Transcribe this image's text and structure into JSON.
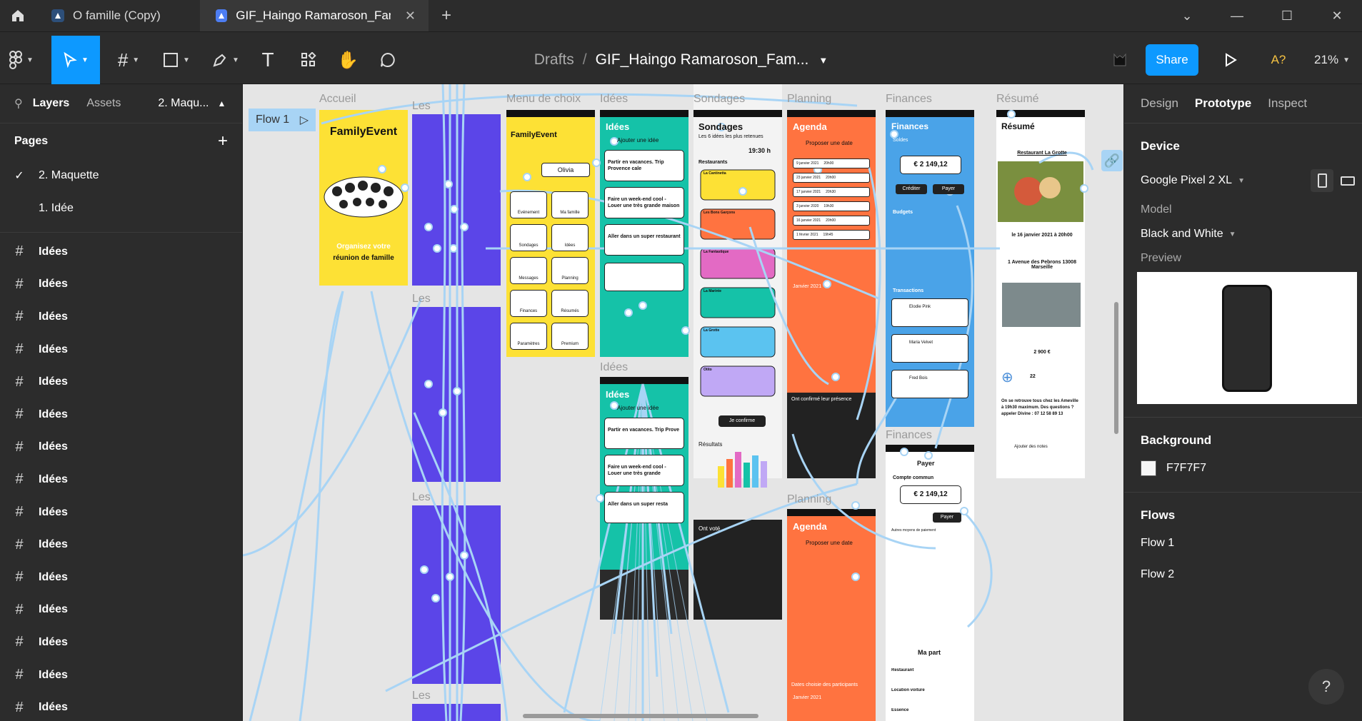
{
  "tabs": {
    "items": [
      {
        "label": "O famille (Copy)"
      },
      {
        "label": "GIF_Haingo Ramaroson_FamilyEvent_Do"
      }
    ]
  },
  "toolbar": {
    "breadcrumb_root": "Drafts",
    "breadcrumb_sep": "/",
    "file_name": "GIF_Haingo Ramaroson_Fam...",
    "share_label": "Share",
    "ai_label": "A?",
    "zoom": "21%"
  },
  "left_panel": {
    "tabs": {
      "layers": "Layers",
      "assets": "Assets",
      "page_selector": "2. Maqu..."
    },
    "pages_title": "Pages",
    "pages": [
      {
        "label": "2. Maquette",
        "selected": true
      },
      {
        "label": "1. Idée",
        "selected": false
      }
    ],
    "layers": [
      "Idées",
      "Idées",
      "Idées",
      "Idées",
      "Idées",
      "Idées",
      "Idées",
      "Idées",
      "Idées",
      "Idées",
      "Idées",
      "Idées",
      "Idées",
      "Idées",
      "Idées"
    ]
  },
  "canvas": {
    "flow_badge": "Flow 1",
    "frames": {
      "accueil": {
        "label": "Accueil",
        "title": "FamilyEvent",
        "tagline_1": "Organisez votre",
        "tagline_2": "réunion de famille"
      },
      "les": {
        "label": "Les"
      },
      "les2": {
        "label": "Les"
      },
      "les3": {
        "label": "Les"
      },
      "les4": {
        "label": "Les"
      },
      "menu": {
        "label": "Menu de choix",
        "user": "Olivia",
        "items": [
          "Evénement",
          "Ma famille",
          "Sondages",
          "Idées",
          "Messages",
          "Planning",
          "Finances",
          "Résumés",
          "Paramètres",
          "Premium"
        ]
      },
      "idees": {
        "label": "Idées",
        "title": "Idées",
        "add": "Ajouter une idée",
        "cards": [
          "Partir en vacances. Trip Provence cale",
          "Faire un week-end cool - Louer une très grande maison",
          "Aller dans un super restaurant"
        ]
      },
      "idees2": {
        "label": "Idées",
        "title": "Idées",
        "add": "Ajouter une idée",
        "cards": [
          "Partir en vacances. Trip Prove",
          "Faire un week-end cool - Louer une très grande",
          "Aller dans un super resta"
        ]
      },
      "sondages": {
        "label": "Sondages",
        "title": "Sondages",
        "subtitle": "Les 6 idées les plus retenues",
        "time": "19:30 h",
        "restaurants": "Restaurants",
        "options": [
          "La Cantinetta",
          "Les Bons Garçons",
          "La Fantastique",
          "La Marinte",
          "La Grotte",
          "Otito"
        ],
        "confirm": "Je confirme",
        "results": "Résultats",
        "voted": "Ont voté"
      },
      "planning": {
        "label": "Planning",
        "title": "Agenda",
        "propose": "Proposer une date",
        "dates": [
          "9 janvier 2021",
          "23 janvier 2021",
          "17 janvier 2021",
          "3 janvier 2020",
          "16 janvier 2021",
          "1 février 2021"
        ],
        "times": [
          "20h00",
          "20h00",
          "20h30",
          "19h30",
          "20h00",
          "19h45"
        ],
        "month": "Janvier 2021",
        "confirmed": "Ont confirmé leur présence"
      },
      "planning2": {
        "label": "Planning",
        "title": "Agenda",
        "propose": "Proposer une date",
        "chosen": "Dates choisie des participants",
        "month": "Janvier 2021"
      },
      "finances": {
        "label": "Finances",
        "title": "Finances",
        "balance_label": "Soldes",
        "balance": "€ 2 149,12",
        "credit": "Créditer",
        "pay": "Payer",
        "budgets": "Budgets",
        "transactions": "Transactions",
        "tx_names": [
          "Elodie Pink",
          "Maria Velvet",
          "Fred Bois"
        ]
      },
      "finances2": {
        "label": "Finances",
        "title": "Payer",
        "account": "Compte commun",
        "balance": "€ 2 149,12",
        "pay": "Payer",
        "methods": "Autres moyens de paiement",
        "my_share": "Ma part",
        "rows": [
          "Restaurant",
          "Location voiture",
          "Essence"
        ]
      },
      "resume": {
        "label": "Résumé",
        "title": "Résumé",
        "restaurant": "Restaurant La Grotte",
        "date": "le 16 janvier 2021 à 20h00",
        "address": "1 Avenue des Pebrons 13008 Marseille",
        "amount": "2 900 €",
        "count": "22",
        "note": "On se retrouve tous chez les Ameville à 19h30 maximum. Des questions ? appeler Divine : 07 12 58 89 13",
        "add_note": "Ajouter des notes"
      }
    }
  },
  "right_panel": {
    "tabs": {
      "design": "Design",
      "prototype": "Prototype",
      "inspect": "Inspect"
    },
    "device_title": "Device",
    "device_value": "Google Pixel 2 XL",
    "model_label": "Model",
    "model_value": "Black and White",
    "preview_label": "Preview",
    "background_title": "Background",
    "background_hex": "F7F7F7",
    "flows_title": "Flows",
    "flows": [
      "Flow 1",
      "Flow 2"
    ]
  },
  "colors": {
    "accent": "#0d99ff",
    "yellow": "#fde135",
    "purple": "#5b45e8",
    "teal": "#15c2a8",
    "orange": "#ff7340",
    "blue": "#4aa3e8",
    "link": "#a8d4f5"
  },
  "help_label": "?"
}
